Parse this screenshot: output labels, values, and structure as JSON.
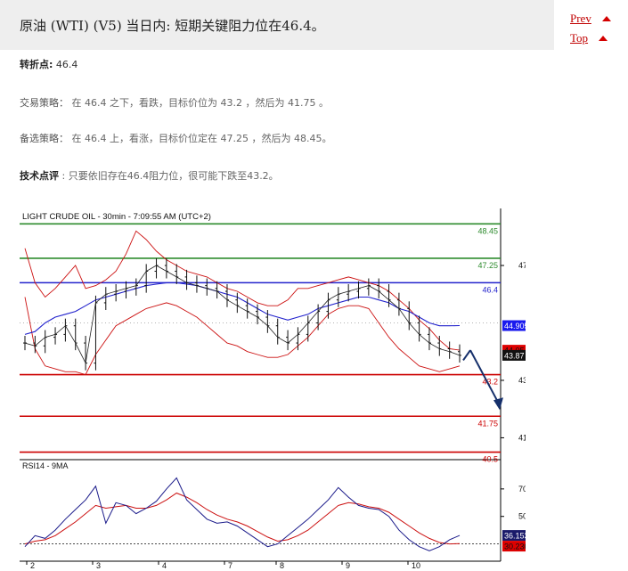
{
  "header": {
    "title": "原油 (WTI) (V5) 当日内: 短期关键阻力位在46.4。"
  },
  "nav": {
    "prev_label": "Prev",
    "top_label": "Top"
  },
  "analysis": {
    "pivot_label": "转折点:",
    "pivot_value": "46.4",
    "strategy_label": "交易策略：",
    "strategy_text": "在 46.4 之下，看跌，目标价位为 43.2 ，然后为 41.75 。",
    "alt_label": "备选策略：",
    "alt_text": "在 46.4 上，看涨，目标价位定在 47.25 ，然后为 48.45。",
    "tech_label": "技术点评",
    "tech_text": ": 只要依旧存在46.4阻力位，很可能下跌至43.2。"
  },
  "chart_data": {
    "type": "line",
    "title": "LIGHT CRUDE OIL - 30min - 7:09:55 AM (UTC+2)",
    "x_labels": [
      "2",
      "3",
      "4",
      "7",
      "8",
      "9",
      "10"
    ],
    "price_axis": {
      "ylim": [
        40.3,
        48.8
      ],
      "ticks": [
        47,
        43,
        41
      ],
      "hidden_tick": 45
    },
    "levels": [
      {
        "value": 48.45,
        "label": "48.45",
        "color": "#2e8b2e"
      },
      {
        "value": 47.25,
        "label": "47.25",
        "color": "#2e8b2e"
      },
      {
        "value": 46.4,
        "label": "46.4",
        "color": "#2222cc"
      },
      {
        "value": 43.2,
        "label": "43.2",
        "color": "#cc0000"
      },
      {
        "value": 41.75,
        "label": "41.75",
        "color": "#cc0000"
      },
      {
        "value": 40.5,
        "label": "40.5",
        "color": "#cc0000"
      }
    ],
    "price_tags": [
      {
        "value": 44.9056,
        "label": "44.9056",
        "bg": "#1a1aee",
        "fg": "#ffffff"
      },
      {
        "value": 44.05,
        "label": "44.05",
        "bg": "#dd0000",
        "fg": "#111111"
      },
      {
        "value": 43.87,
        "label": "43.87",
        "bg": "#111111",
        "fg": "#ffffff"
      }
    ],
    "price_series": [
      44.3,
      44.2,
      44.5,
      44.6,
      44.9,
      44.3,
      43.6,
      45.7,
      46.0,
      46.1,
      46.2,
      46.3,
      46.8,
      47.0,
      46.8,
      46.6,
      46.4,
      46.3,
      46.2,
      46.1,
      45.8,
      45.6,
      45.4,
      45.2,
      44.9,
      44.5,
      44.3,
      44.6,
      45.0,
      45.4,
      45.8,
      46.0,
      46.1,
      46.2,
      46.3,
      46.1,
      45.8,
      45.5,
      45.0,
      44.6,
      44.3,
      44.1,
      44.0,
      43.87
    ],
    "bollinger_upper": [
      47.6,
      46.4,
      45.9,
      46.2,
      46.6,
      47.0,
      46.2,
      46.3,
      46.5,
      46.8,
      47.4,
      48.2,
      47.9,
      47.5,
      47.2,
      47.0,
      46.8,
      46.7,
      46.6,
      46.4,
      46.2,
      46.1,
      45.9,
      45.7,
      45.6,
      45.6,
      45.8,
      46.2,
      46.2,
      46.3,
      46.4,
      46.5,
      46.6,
      46.5,
      46.4,
      46.3,
      46.1,
      45.8,
      45.5,
      45.1,
      44.8,
      44.4,
      44.1,
      44.05
    ],
    "bollinger_lower": [
      45.9,
      44.1,
      43.5,
      43.4,
      43.3,
      43.3,
      43.2,
      43.9,
      44.4,
      44.9,
      45.1,
      45.3,
      45.5,
      45.6,
      45.7,
      45.6,
      45.4,
      45.2,
      44.9,
      44.6,
      44.3,
      44.2,
      44.0,
      43.9,
      43.8,
      43.8,
      43.9,
      44.2,
      44.5,
      44.9,
      45.3,
      45.5,
      45.6,
      45.6,
      45.5,
      45.0,
      44.5,
      44.1,
      43.8,
      43.5,
      43.4,
      43.3,
      43.4,
      43.5
    ],
    "moving_average": [
      44.6,
      44.7,
      45.0,
      45.2,
      45.3,
      45.4,
      45.6,
      45.8,
      45.9,
      46.0,
      46.1,
      46.2,
      46.3,
      46.35,
      46.4,
      46.4,
      46.35,
      46.3,
      46.2,
      46.1,
      46.0,
      45.9,
      45.7,
      45.5,
      45.3,
      45.2,
      45.1,
      45.2,
      45.3,
      45.5,
      45.6,
      45.7,
      45.8,
      45.9,
      45.9,
      45.8,
      45.7,
      45.5,
      45.4,
      45.2,
      45.0,
      44.9,
      44.9,
      44.9056
    ],
    "rsi": {
      "title": "RSI14 - 9MA",
      "ylim": [
        20,
        90
      ],
      "ticks": [
        70,
        50
      ],
      "value": 36.1531,
      "value_label": "36.1531",
      "ma_value": 30.2308,
      "ma_label": "30.2308",
      "series": [
        28,
        36,
        34,
        40,
        48,
        55,
        62,
        72,
        45,
        60,
        58,
        52,
        56,
        61,
        70,
        78,
        62,
        55,
        48,
        45,
        46,
        43,
        38,
        33,
        28,
        30,
        36,
        42,
        48,
        55,
        62,
        71,
        64,
        58,
        56,
        55,
        50,
        40,
        33,
        28,
        25,
        28,
        33,
        36.15
      ],
      "ma_series": [
        30,
        32,
        33,
        36,
        41,
        46,
        52,
        58,
        56,
        57,
        58,
        56,
        56,
        58,
        62,
        67,
        64,
        60,
        55,
        51,
        48,
        46,
        43,
        39,
        35,
        32,
        33,
        36,
        40,
        46,
        52,
        58,
        60,
        59,
        57,
        56,
        53,
        48,
        43,
        38,
        34,
        31,
        30,
        30.23
      ]
    },
    "projection": {
      "from": 44.05,
      "to": 42.0
    }
  }
}
